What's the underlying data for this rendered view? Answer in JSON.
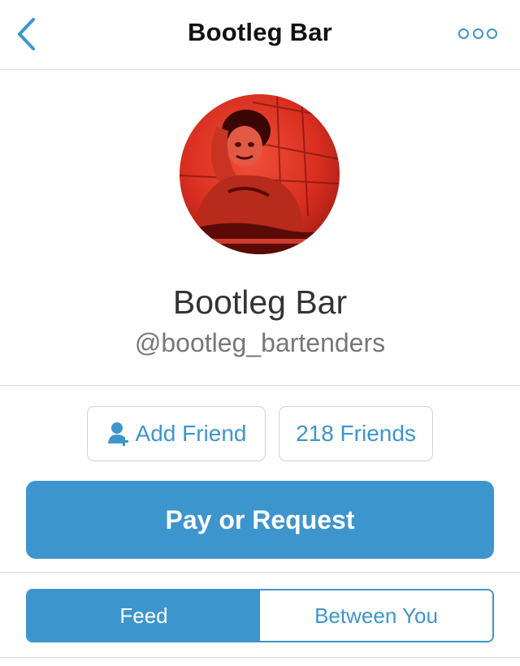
{
  "nav": {
    "title": "Bootleg Bar"
  },
  "profile": {
    "name": "Bootleg Bar",
    "handle": "@bootleg_bartenders"
  },
  "actions": {
    "add_friend_label": "Add Friend",
    "friends_count_label": "218 Friends",
    "pay_label": "Pay or Request"
  },
  "tabs": [
    {
      "label": "Feed",
      "active": true
    },
    {
      "label": "Between You",
      "active": false
    }
  ],
  "icons": {
    "back": "chevron-left-icon",
    "more": "more-options-icon",
    "add_friend": "add-person-icon"
  },
  "colors": {
    "accent": "#3d95ce",
    "avatar_tint": "#e8392a"
  }
}
